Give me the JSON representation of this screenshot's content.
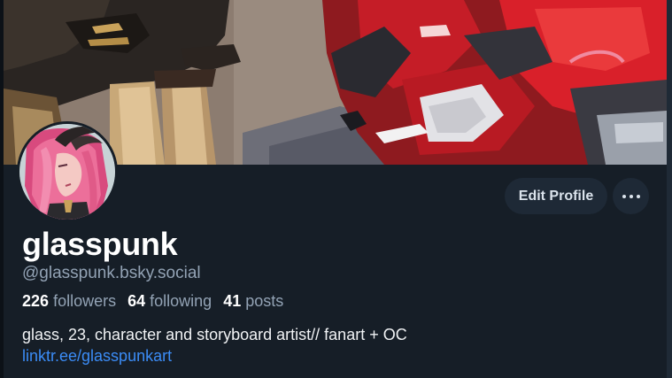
{
  "profile": {
    "display_name": "glasspunk",
    "handle": "@glasspunk.bsky.social",
    "stats": {
      "followers_count": "226",
      "followers_label": "followers",
      "following_count": "64",
      "following_label": "following",
      "posts_count": "41",
      "posts_label": "posts"
    },
    "bio": "glass, 23, character and storyboard artist// fanart + OC",
    "bio_link": "linktr.ee/glasspunkart"
  },
  "actions": {
    "edit_profile_label": "Edit Profile",
    "more_icon": "ellipsis-icon"
  },
  "colors": {
    "background": "#161e27",
    "button_bg": "#1e2936",
    "text_primary": "#ffffff",
    "text_secondary": "#93a3b5",
    "link": "#3b8cf6",
    "banner_accent_red": "#d9202a",
    "avatar_hair_pink": "#e2568a"
  }
}
